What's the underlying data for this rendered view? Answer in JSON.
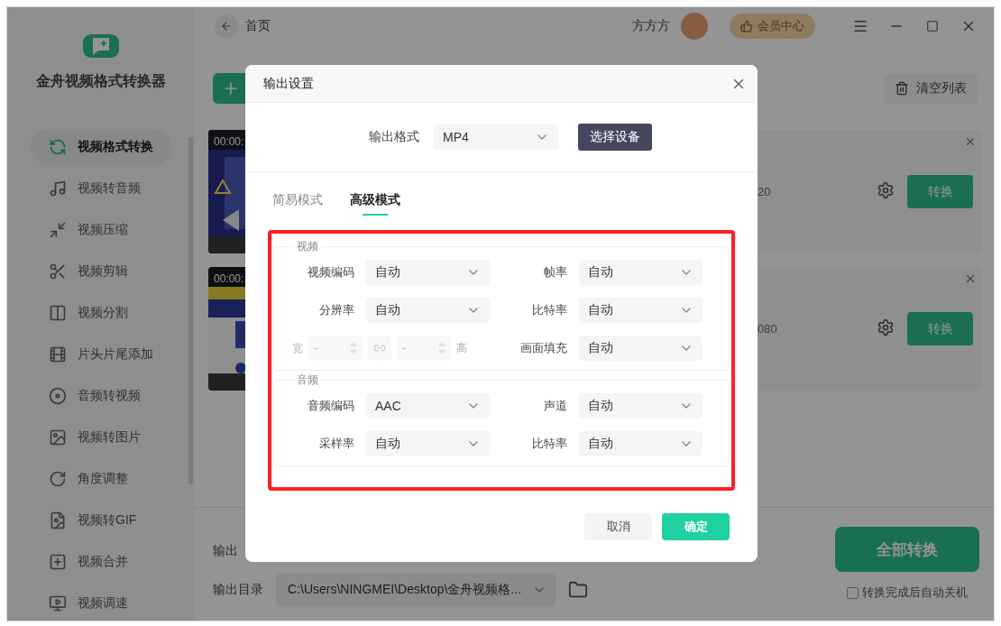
{
  "app": {
    "title": "金舟视频格式转换器"
  },
  "sidebar": {
    "items": [
      {
        "label": "视频格式转换",
        "selected": true
      },
      {
        "label": "视频转音频",
        "selected": false
      },
      {
        "label": "视频压缩",
        "selected": false
      },
      {
        "label": "视频剪辑",
        "selected": false
      },
      {
        "label": "视频分割",
        "selected": false
      },
      {
        "label": "片头片尾添加",
        "selected": false
      },
      {
        "label": "音频转视频",
        "selected": false
      },
      {
        "label": "视频转图片",
        "selected": false
      },
      {
        "label": "角度调整",
        "selected": false
      },
      {
        "label": "视频转GIF",
        "selected": false
      },
      {
        "label": "视频合并",
        "selected": false
      },
      {
        "label": "视频调速",
        "selected": false
      }
    ]
  },
  "topbar": {
    "back_label": "首页",
    "username": "方方方",
    "vip_label": "会员中心"
  },
  "toolbar": {
    "clear_label": "清空列表"
  },
  "files": [
    {
      "duration": "00:00:",
      "info": "20",
      "convert_label": "转换"
    },
    {
      "duration": "00:00:",
      "info": "080",
      "convert_label": "转换"
    }
  ],
  "bottom": {
    "output_info_label": "输出",
    "output_dir_label": "输出目录",
    "output_dir": "C:\\Users\\NINGMEI\\Desktop\\金舟视频格...",
    "convert_all_label": "全部转换",
    "auto_shutdown": {
      "label": "转换完成后自动关机",
      "checked": false
    }
  },
  "dialog": {
    "title": "输出设置",
    "format_label": "输出格式",
    "format": "MP4",
    "device_button": "选择设备",
    "tabs": [
      {
        "label": "简易模式",
        "selected": false
      },
      {
        "label": "高级模式",
        "selected": true
      }
    ],
    "sections": [
      {
        "title": "视频",
        "fields": [
          {
            "kind": "select",
            "label": "视频编码",
            "value": "自动"
          },
          {
            "kind": "select",
            "label": "帧率",
            "value": "自动"
          },
          {
            "kind": "select",
            "label": "分辨率",
            "value": "自动"
          },
          {
            "kind": "select",
            "label": "比特率",
            "value": "自动"
          },
          {
            "kind": "size",
            "width_label": "宽",
            "width_placeholder": "-",
            "height_placeholder": "-",
            "height_label": "高",
            "disabled": true
          },
          {
            "kind": "select",
            "label": "画面填充",
            "value": "自动"
          }
        ]
      },
      {
        "title": "音频",
        "fields": [
          {
            "kind": "select",
            "label": "音频编码",
            "value": "AAC"
          },
          {
            "kind": "select",
            "label": "声道",
            "value": "自动"
          },
          {
            "kind": "select",
            "label": "采样率",
            "value": "自动"
          },
          {
            "kind": "select",
            "label": "比特率",
            "value": "自动"
          }
        ]
      }
    ],
    "buttons": [
      {
        "kind": "cancel",
        "label": "取消"
      },
      {
        "kind": "ok",
        "label": "确定"
      }
    ]
  }
}
